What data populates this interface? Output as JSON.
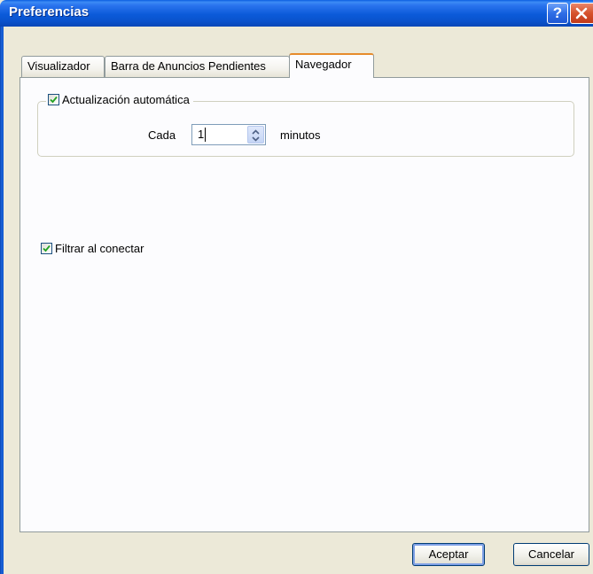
{
  "window": {
    "title": "Preferencias",
    "help_label": "?"
  },
  "tabs": [
    {
      "label": "Visualizador",
      "active": false
    },
    {
      "label": "Barra de Anuncios Pendientes",
      "active": false
    },
    {
      "label": "Navegador",
      "active": true
    }
  ],
  "navegador": {
    "auto_update": {
      "label": "Actualización automática",
      "checked": true,
      "every_label": "Cada",
      "interval_value": "1",
      "unit_label": "minutos"
    },
    "filter_on_connect": {
      "label": "Filtrar al conectar",
      "checked": true
    }
  },
  "buttons": {
    "accept_label": "Aceptar",
    "cancel_label": "Cancelar"
  },
  "icons": {
    "help": "help-icon",
    "close": "close-icon",
    "check": "check-icon",
    "spin_up": "chevron-up-icon",
    "spin_down": "chevron-down-icon"
  },
  "colors": {
    "title_bar": "#0a52cc",
    "active_tab_accent": "#e68b2c",
    "check_mark": "#21a121",
    "close_button": "#d6522c"
  }
}
